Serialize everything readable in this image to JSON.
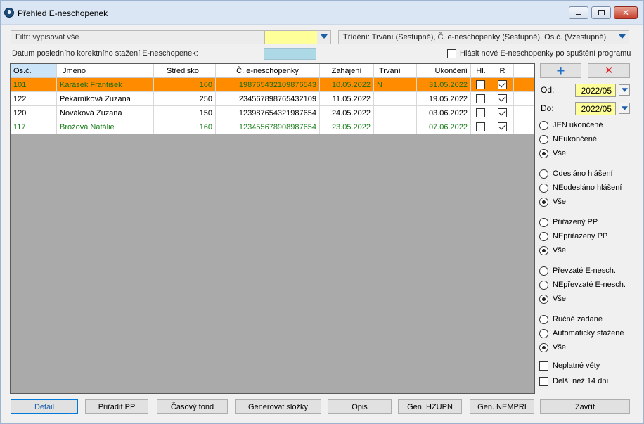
{
  "window": {
    "title": "Přehled E-neschopenek"
  },
  "filter": {
    "label": "Filtr: vypisovat vše"
  },
  "sort": {
    "label": "Třídění: Trvání (Sestupně), Č. e-neschopenky (Sestupně), Os.č. (Vzestupně)"
  },
  "download_label": "Datum posledního korektního stažení E-neschopenek:",
  "notify": {
    "label": "Hlásit nové E-neschopenky po spuštění programu",
    "checked": false
  },
  "table": {
    "columns": [
      "Os.č.",
      "Jméno",
      "Středisko",
      "Č. e-neschopenky",
      "Zahájení",
      "Trvání",
      "Ukončení",
      "Hl.",
      "R"
    ],
    "rows": [
      {
        "os": "101",
        "jmeno": "Karásek František",
        "stredisko": "160",
        "cislo": "198765432109876543",
        "zahajeni": "10.05.2022",
        "trvani": "N",
        "ukonceni": "31.05.2022",
        "hl": false,
        "r": true,
        "style": "selected"
      },
      {
        "os": "122",
        "jmeno": "Pekárníková Zuzana",
        "stredisko": "250",
        "cislo": "234567898765432109",
        "zahajeni": "11.05.2022",
        "trvani": "",
        "ukonceni": "19.05.2022",
        "hl": false,
        "r": true,
        "style": "normal"
      },
      {
        "os": "120",
        "jmeno": "Nováková Zuzana",
        "stredisko": "150",
        "cislo": "123987654321987654",
        "zahajeni": "24.05.2022",
        "trvani": "",
        "ukonceni": "03.06.2022",
        "hl": false,
        "r": true,
        "style": "normal"
      },
      {
        "os": "117",
        "jmeno": "Brožová Natálie",
        "stredisko": "160",
        "cislo": "123455678908987654",
        "zahajeni": "23.05.2022",
        "trvani": "",
        "ukonceni": "07.06.2022",
        "hl": false,
        "r": true,
        "style": "green"
      }
    ]
  },
  "dates": {
    "od_label": "Od:",
    "od_value": "2022/05",
    "do_label": "Do:",
    "do_value": "2022/05"
  },
  "options": {
    "g1": [
      "JEN ukončené",
      "NEukončené",
      "Vše"
    ],
    "g2": [
      "Odesláno hlášení",
      "NEodesláno hlášení",
      "Vše"
    ],
    "g3": [
      "Přiřazený PP",
      "NEpřiřazený PP",
      "Vše"
    ],
    "g4": [
      "Převzaté E-nesch.",
      "NEpřevzaté E-nesch.",
      "Vše"
    ],
    "g5": [
      "Ručně zadané",
      "Automaticky stažené",
      "Vše"
    ],
    "selected_index": 2,
    "neplatne": "Neplatné věty",
    "delsi": "Delší než 14 dní"
  },
  "buttons": {
    "detail": "Detail",
    "priradit": "Přiřadit PP",
    "casovy": "Časový fond",
    "generovat": "Generovat složky",
    "opis": "Opis",
    "hzupn": "Gen. HZUPN",
    "nempri": "Gen. NEMPRI",
    "zavrit": "Zavřít"
  },
  "colors": {
    "selected_row": "#ff8c00",
    "yellow_field": "#ffff99",
    "blue_field": "#add8e6",
    "green_text": "#1a7f1a",
    "grid_bg": "#aaaaaa"
  },
  "icons": [
    "app-icon",
    "minimize-icon",
    "maximize-icon",
    "close-icon",
    "dropdown-arrow-icon",
    "plus-icon",
    "cross-icon"
  ]
}
